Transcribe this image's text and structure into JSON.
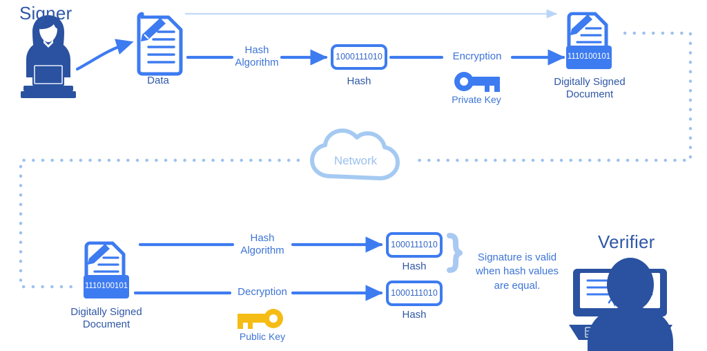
{
  "diagram": {
    "title_signer": "Signer",
    "title_verifier": "Verifier",
    "network_label": "Network"
  },
  "colors": {
    "primary_blue": "#3d7bf0",
    "dark_navy": "#2a52a0",
    "label_blue": "#3d74d6",
    "light_blue": "#a8c8f0",
    "pale_blue": "#c9def8",
    "key_yellow": "#f5bc15",
    "white": "#ffffff"
  },
  "top_flow": {
    "signer_label": "Signer",
    "data_label": "Data",
    "hash_algorithm_label": "Hash\nAlgorithm",
    "hash_value": "1000111010",
    "hash_label": "Hash",
    "encryption_label": "Encryption",
    "private_key_label": "Private Key",
    "signed_doc_tag": "1110100101",
    "signed_doc_label": "Digitally Signed\nDocument"
  },
  "bottom_flow": {
    "signed_doc_tag": "1110100101",
    "signed_doc_label": "Digitally Signed\nDocument",
    "hash_algorithm_label": "Hash\nAlgorithm",
    "decryption_label": "Decryption",
    "public_key_label": "Public Key",
    "hash_value_top": "1000111010",
    "hash_label_top": "Hash",
    "hash_value_bottom": "1000111010",
    "hash_label_bottom": "Hash",
    "comparison_note": "Signature is valid\nwhen hash values\nare equal.",
    "verifier_label": "Verifier"
  }
}
